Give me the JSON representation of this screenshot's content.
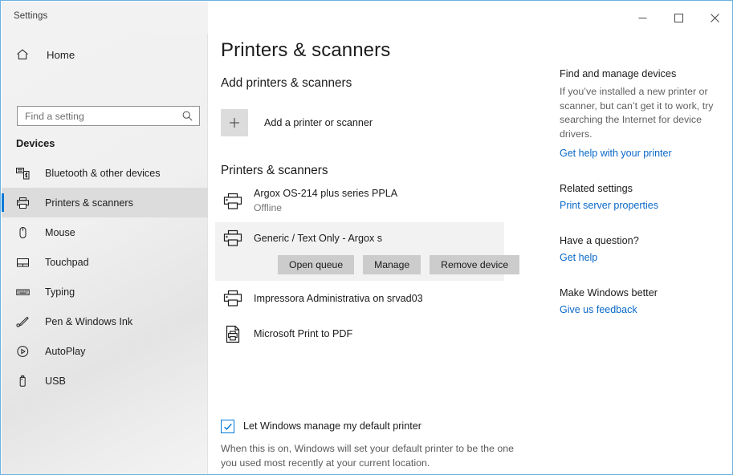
{
  "window": {
    "title": "Settings",
    "controls": [
      {
        "name": "minimize",
        "glyph": "minimize-icon"
      },
      {
        "name": "maximize",
        "glyph": "maximize-icon"
      },
      {
        "name": "close",
        "glyph": "close-icon"
      }
    ],
    "border_color": "#6ab0e0"
  },
  "sidebar": {
    "home_label": "Home",
    "home_icon": "home-icon",
    "search": {
      "placeholder": "Find a setting",
      "value": "",
      "icon": "search-icon"
    },
    "group_label": "Devices",
    "items": [
      {
        "label": "Bluetooth & other devices",
        "icon": "bluetooth-devices-icon",
        "active": false
      },
      {
        "label": "Printers & scanners",
        "icon": "printer-icon",
        "active": true
      },
      {
        "label": "Mouse",
        "icon": "mouse-icon",
        "active": false
      },
      {
        "label": "Touchpad",
        "icon": "touchpad-icon",
        "active": false
      },
      {
        "label": "Typing",
        "icon": "keyboard-icon",
        "active": false
      },
      {
        "label": "Pen & Windows Ink",
        "icon": "pen-icon",
        "active": false
      },
      {
        "label": "AutoPlay",
        "icon": "autoplay-icon",
        "active": false
      },
      {
        "label": "USB",
        "icon": "usb-icon",
        "active": false
      }
    ],
    "accent_color": "#0078d7"
  },
  "main": {
    "page_title": "Printers & scanners",
    "add_section": {
      "heading": "Add printers & scanners",
      "button_label": "Add a printer or scanner",
      "icon": "plus-icon"
    },
    "list_section": {
      "heading": "Printers & scanners",
      "printers": [
        {
          "name": "Argox OS-214 plus series PPLA",
          "status": "Offline",
          "icon": "printer-icon",
          "selected": false
        },
        {
          "name": "Generic / Text Only - Argox s",
          "status": "",
          "icon": "printer-icon",
          "selected": true,
          "actions": [
            {
              "label": "Open queue",
              "name": "open-queue-button"
            },
            {
              "label": "Manage",
              "name": "manage-button"
            },
            {
              "label": "Remove device",
              "name": "remove-device-button"
            }
          ]
        },
        {
          "name": "Impressora Administrativa on srvad03",
          "status": "",
          "icon": "printer-icon",
          "selected": false
        },
        {
          "name": "Microsoft Print to PDF",
          "status": "",
          "icon": "print-to-pdf-icon",
          "selected": false
        }
      ]
    },
    "default_printer": {
      "checked": true,
      "label": "Let Windows manage my default printer",
      "description": "When this is on, Windows will set your default printer to be the one you used most recently at your current location."
    }
  },
  "aside": {
    "blocks": [
      {
        "heading": "Find and manage devices",
        "body": "If you’ve installed a new printer or scanner, but can’t get it to work, try searching the Internet for device drivers.",
        "link": "Get help with your printer"
      },
      {
        "heading": "Related settings",
        "body": "",
        "link": "Print server properties"
      },
      {
        "heading": "Have a question?",
        "body": "",
        "link": "Get help"
      },
      {
        "heading": "Make Windows better",
        "body": "",
        "link": "Give us feedback"
      }
    ],
    "link_color": "#0a69c7"
  },
  "annotation": {
    "type": "curved-arrow",
    "points_to": "Manage",
    "color_light": "#4fa9e8",
    "color_dark": "#1478cd"
  }
}
